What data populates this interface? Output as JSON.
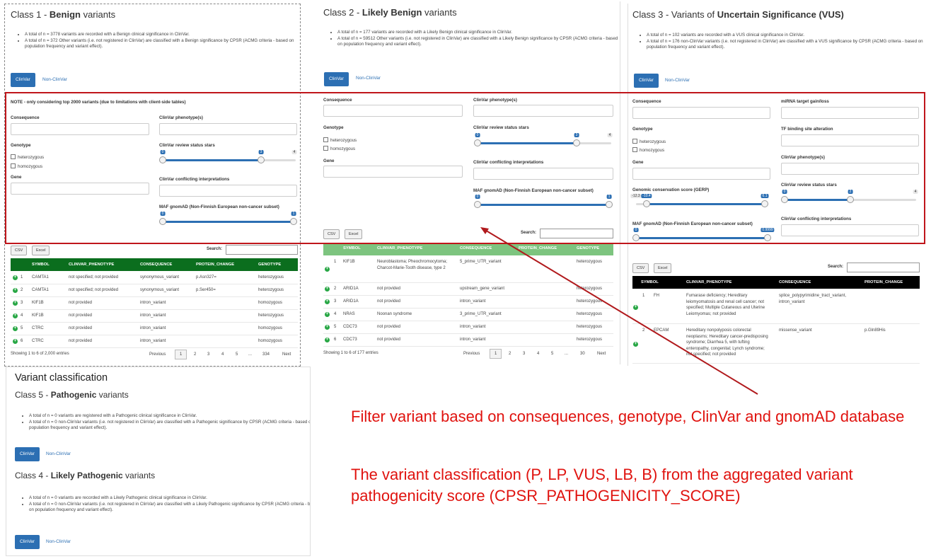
{
  "class1": {
    "title_prefix": "Class 1 - ",
    "title_bold": "Benign",
    "title_suffix": " variants",
    "bullets": [
      "A total of n = 3778 variants are recorded with a Benign clinical significance in ClinVar.",
      "A total of n = 372 Other variants (i.e. not registered in ClinVar) are classified with a Benign significance by CPSR (ACMG criteria - based on population frequency and variant effect)."
    ],
    "tab_active": "ClinVar",
    "tab_other": "Non-ClinVar",
    "note": "NOTE - only considering top 2000 variants (due to limitations with client-side tables)",
    "filters": {
      "consequence": "Consequence",
      "clinvar_phenotype": "ClinVar phenotype(s)",
      "genotype": "Genotype",
      "heterozygous": "heterozygous",
      "homozygous": "homozygous",
      "review_stars": "ClinVar review status stars",
      "gene": "Gene",
      "conflicting": "ClinVar conflicting interpretations",
      "gnomad": "MAF gnomAD (Non-Finnish European non-cancer subset)",
      "stars_min": "0",
      "stars_max": "3",
      "stars_limit": "4",
      "maf_min": "0",
      "maf_max": "1"
    },
    "csv": "CSV",
    "excel": "Excel",
    "search_label": "Search:",
    "columns": [
      "SYMBOL",
      "CLINVAR_PHENOTYPE",
      "CONSEQUENCE",
      "PROTEIN_CHANGE",
      "GENOTYPE"
    ],
    "rows": [
      {
        "n": "1",
        "symbol": "CAMTA1",
        "phen": "not specified; not provided",
        "cons": "synonymous_variant",
        "prot": "p.Asn327=",
        "geno": "heterozygous"
      },
      {
        "n": "2",
        "symbol": "CAMTA1",
        "phen": "not specified; not provided",
        "cons": "synonymous_variant",
        "prot": "p.Ser450=",
        "geno": "heterozygous"
      },
      {
        "n": "3",
        "symbol": "KIF1B",
        "phen": "not provided",
        "cons": "intron_variant",
        "prot": "",
        "geno": "homozygous"
      },
      {
        "n": "4",
        "symbol": "KIF1B",
        "phen": "not provided",
        "cons": "intron_variant",
        "prot": "",
        "geno": "heterozygous"
      },
      {
        "n": "5",
        "symbol": "CTRC",
        "phen": "not provided",
        "cons": "intron_variant",
        "prot": "",
        "geno": "homozygous"
      },
      {
        "n": "6",
        "symbol": "CTRC",
        "phen": "not provided",
        "cons": "intron_variant",
        "prot": "",
        "geno": "homozygous"
      }
    ],
    "showing": "Showing 1 to 6 of 2,000 entries",
    "pager": [
      "Previous",
      "1",
      "2",
      "3",
      "4",
      "5",
      "...",
      "334",
      "Next"
    ]
  },
  "class2": {
    "title_prefix": "Class 2 - ",
    "title_bold": "Likely Benign",
    "title_suffix": " variants",
    "bullets": [
      "A total of n = 177 variants are recorded with a Likely Benign clinical significance in ClinVar.",
      "A total of n = 59512 Other variants (i.e. not registered in ClinVar) are classified with a Likely Benign significance by CPSR (ACMG criteria - based on population frequency and variant effect)."
    ],
    "tab_active": "ClinVar",
    "tab_other": "Non-ClinVar",
    "filters": {
      "consequence": "Consequence",
      "clinvar_phenotype": "ClinVar phenotype(s)",
      "genotype": "Genotype",
      "heterozygous": "heterozygous",
      "homozygous": "homozygous",
      "review_stars": "ClinVar review status stars",
      "gene": "Gene",
      "conflicting": "ClinVar conflicting interpretations",
      "gnomad": "MAF gnomAD (Non-Finnish European non-cancer subset)",
      "stars_min": "0",
      "stars_max": "3",
      "stars_limit": "4",
      "maf_min": "0",
      "maf_max": "1"
    },
    "csv": "CSV",
    "excel": "Excel",
    "search_label": "Search:",
    "columns": [
      "SYMBOL",
      "CLINVAR_PHENOTYPE",
      "CONSEQUENCE",
      "PROTEIN_CHANGE",
      "GENOTYPE"
    ],
    "rows": [
      {
        "n": "1",
        "symbol": "KIF1B",
        "phen": "Neuroblastoma; Pheochromocytoma; Charcot-Marie-Tooth disease, type 2",
        "cons": "5_prime_UTR_variant",
        "prot": "",
        "geno": "heterozygous"
      },
      {
        "n": "2",
        "symbol": "ARID1A",
        "phen": "not provided",
        "cons": "upstream_gene_variant",
        "prot": "",
        "geno": "heterozygous"
      },
      {
        "n": "3",
        "symbol": "ARID1A",
        "phen": "not provided",
        "cons": "intron_variant",
        "prot": "",
        "geno": "heterozygous"
      },
      {
        "n": "4",
        "symbol": "NRAS",
        "phen": "Noonan syndrome",
        "cons": "3_prime_UTR_variant",
        "prot": "",
        "geno": "heterozygous"
      },
      {
        "n": "5",
        "symbol": "CDC73",
        "phen": "not provided",
        "cons": "intron_variant",
        "prot": "",
        "geno": "heterozygous"
      },
      {
        "n": "6",
        "symbol": "CDC73",
        "phen": "not provided",
        "cons": "intron_variant",
        "prot": "",
        "geno": "heterozygous"
      }
    ],
    "showing": "Showing 1 to 6 of 177 entries",
    "pager": [
      "Previous",
      "1",
      "2",
      "3",
      "4",
      "5",
      "...",
      "30",
      "Next"
    ]
  },
  "class3": {
    "title_prefix": "Class 3 - Variants of ",
    "title_bold": "Uncertain Significance (VUS)",
    "bullets": [
      "A total of n = 102 variants are recorded with a VUS clinical significance in ClinVar.",
      "A total of n = 176 non-ClinVar variants (i.e. not registered in ClinVar) are classified with a VUS significance by CPSR (ACMG criteria - based on population frequency and variant effect)."
    ],
    "tab_active": "ClinVar",
    "tab_other": "Non-ClinVar",
    "filters": {
      "consequence": "Consequence",
      "mirna": "miRNA target gain/loss",
      "genotype": "Genotype",
      "tf": "TF binding site alteration",
      "heterozygous": "heterozygous",
      "homozygous": "homozygous",
      "clinvar_phenotype": "ClinVar phenotype(s)",
      "gene": "Gene",
      "review_stars": "ClinVar review status stars",
      "gerp": "Genomic conservation score (GERP)",
      "conflicting": "ClinVar conflicting interpretations",
      "gnomad": "MAF gnomAD (Non-Finnish European non-cancer subset)",
      "gerp_min": "-12.3",
      "gerp_lo": "-10.4",
      "gerp_max": "6.1",
      "stars_min": "0",
      "stars_max": "2",
      "stars_limit": "4",
      "maf_min": "0",
      "maf_max": "0.9999"
    },
    "csv": "CSV",
    "excel": "Excel",
    "search_label": "Search:",
    "columns": [
      "SYMBOL",
      "CLINVAR_PHENOTYPE",
      "CONSEQUENCE",
      "PROTEIN_CHANGE"
    ],
    "rows": [
      {
        "n": "1",
        "symbol": "FH",
        "phen": "Fumarase deficiency; Hereditary leiomyomatosis and renal cell cancer; not specified; Multiple Cutaneous and Uterine Leiomyomas; not provided",
        "cons": "splice_polypyrimidine_tract_variant, intron_variant",
        "prot": ""
      },
      {
        "n": "2",
        "symbol": "EPCAM",
        "phen": "Hereditary nonpolyposis colorectal neoplasms; Hereditary cancer-predisposing syndrome; Diarrhea 5, with tufting enteropathy, congenital; Lynch syndrome; not specified; not provided",
        "cons": "missense_variant",
        "prot": "p.Gln89His"
      }
    ]
  },
  "classification": {
    "heading": "Variant classification",
    "class5_prefix": "Class 5 - ",
    "class5_bold": "Pathogenic",
    "class5_suffix": " variants",
    "class5_bullets": [
      "A total of n = 0 variants are registered with a Pathogenic clinical significance in ClinVar.",
      "A total of n = 0 non-ClinVar variants (i.e. not registered in ClinVar) are classified with a Pathogenic significance by CPSR (ACMG criteria - based on population frequency and variant effect)."
    ],
    "class4_prefix": "Class 4 - ",
    "class4_bold": "Likely Pathogenic",
    "class4_suffix": " variants",
    "class4_bullets": [
      "A total of n = 0 variants are recorded with a Likely Pathogenic clinical significance in ClinVar.",
      "A total of n = 0 non-ClinVar variants (i.e. not registered in ClinVar) are classified with a Likely Pathogenic significance by CPSR (ACMG criteria - based on population frequency and variant effect)."
    ],
    "tab_active": "ClinVar",
    "tab_other": "Non-ClinVar"
  },
  "annotation": {
    "line1": "Filter variant based on consequences, genotype, ClinVar and gnomAD database",
    "line2": "The variant classification (P, LP, VUS, LB, B) from the aggregated variant pathogenicity score (CPSR_PATHOGENICITY_SCORE)"
  },
  "colors": {
    "class1_header": "#0b6e1e",
    "class2_header": "#7dc47f",
    "class3_header": "#000000",
    "tab_blue": "#2c6fb3",
    "highlight_red": "#c0161b",
    "annotation_red": "#e0130f"
  }
}
